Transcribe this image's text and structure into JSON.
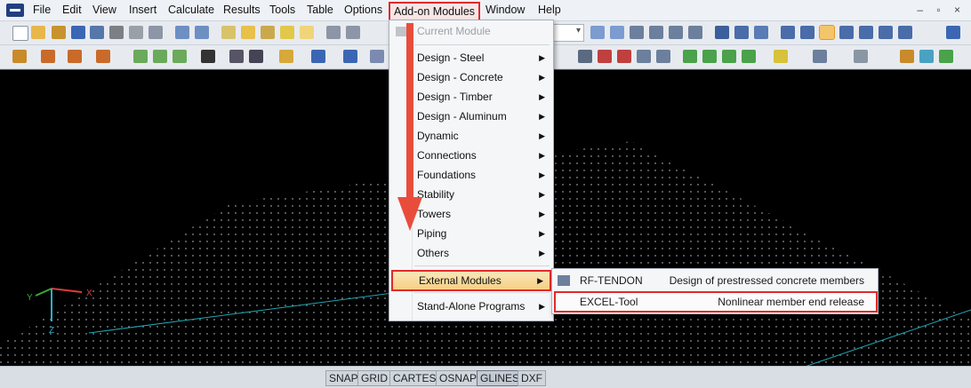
{
  "menubar": {
    "items": [
      "File",
      "Edit",
      "View",
      "Insert",
      "Calculate",
      "Results",
      "Tools",
      "Table",
      "Options",
      "Add-on Modules",
      "Window",
      "Help"
    ]
  },
  "window_controls": "– ▫ ×",
  "addon_menu": {
    "current_module": "Current Module",
    "items": [
      "Design - Steel",
      "Design - Concrete",
      "Design - Timber",
      "Design - Aluminum",
      "Dynamic",
      "Connections",
      "Foundations",
      "Stability",
      "Towers",
      "Piping",
      "Others"
    ],
    "external_modules": "External Modules",
    "stand_alone": "Stand-Alone Programs"
  },
  "external_submenu": {
    "items": [
      {
        "name": "RF-TENDON",
        "desc": "Design of prestressed concrete members"
      },
      {
        "name": "EXCEL-Tool",
        "desc": "Nonlinear member end release"
      }
    ]
  },
  "axes": {
    "x": "X",
    "y": "Y",
    "z": "Z"
  },
  "statusbar": {
    "buttons": [
      "SNAP",
      "GRID",
      "CARTES",
      "OSNAP",
      "GLINES",
      "DXF"
    ]
  },
  "colors": {
    "highlight_border": "#e02b2b",
    "viewport_bg": "#000000",
    "grid_line": "#1fa7b5",
    "axis_x": "#e03a3a",
    "axis_y": "#3aa83a",
    "axis_z": "#2ab0c8"
  }
}
